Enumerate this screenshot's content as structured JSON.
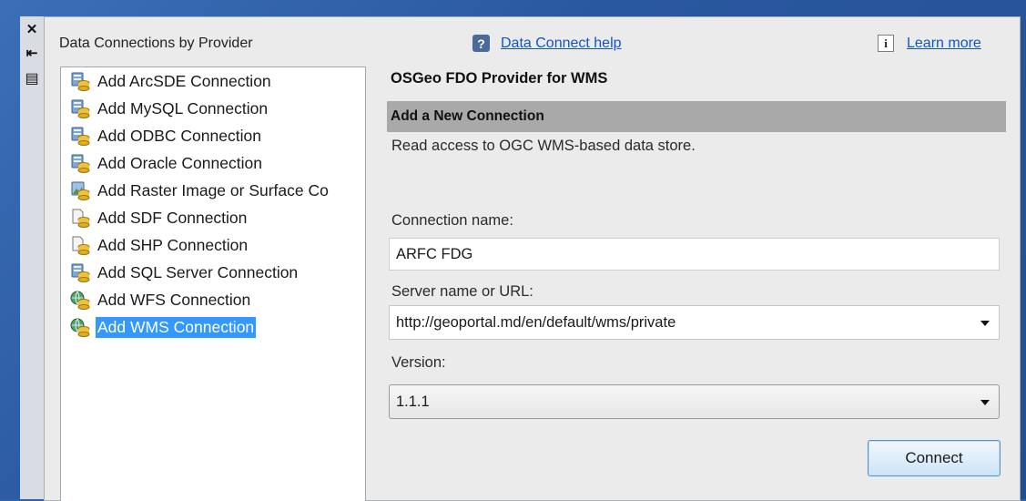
{
  "sidebar_tools": {
    "close_glyph": "✕",
    "pin_glyph": "⇤",
    "props_glyph": "▤"
  },
  "left": {
    "header": "Data Connections by Provider",
    "items": [
      {
        "label": "Add ArcSDE Connection",
        "icon": "database-connect-icon",
        "selected": false
      },
      {
        "label": "Add MySQL Connection",
        "icon": "database-connect-icon",
        "selected": false
      },
      {
        "label": "Add ODBC Connection",
        "icon": "database-connect-icon",
        "selected": false
      },
      {
        "label": "Add Oracle Connection",
        "icon": "database-connect-icon",
        "selected": false
      },
      {
        "label": "Add Raster Image or Surface Co",
        "icon": "raster-connect-icon",
        "selected": false
      },
      {
        "label": "Add SDF Connection",
        "icon": "file-connect-icon",
        "selected": false
      },
      {
        "label": "Add SHP Connection",
        "icon": "file-connect-icon",
        "selected": false
      },
      {
        "label": "Add SQL Server Connection",
        "icon": "database-connect-icon",
        "selected": false
      },
      {
        "label": "Add WFS Connection",
        "icon": "globe-connect-icon",
        "selected": false
      },
      {
        "label": "Add WMS Connection",
        "icon": "globe-connect-icon",
        "selected": true
      }
    ]
  },
  "links": {
    "help_icon_glyph": "?",
    "help": "Data Connect help",
    "info_icon_glyph": "i",
    "learn": "Learn more"
  },
  "form": {
    "provider_title": "OSGeo FDO Provider for WMS",
    "section_title": "Add a New Connection",
    "description": "Read access to OGC WMS-based data store.",
    "connection_name_label": "Connection name:",
    "connection_name_value": "ARFC FDG",
    "server_label": "Server name or URL:",
    "server_value": "http://geoportal.md/en/default/wms/private",
    "version_label": "Version:",
    "version_value": "1.1.1",
    "connect_button": "Connect"
  },
  "colors": {
    "selection": "#3399ff",
    "section_bar": "#a9a9a9",
    "link": "#1155cc",
    "desktop": "#2d63ad"
  }
}
